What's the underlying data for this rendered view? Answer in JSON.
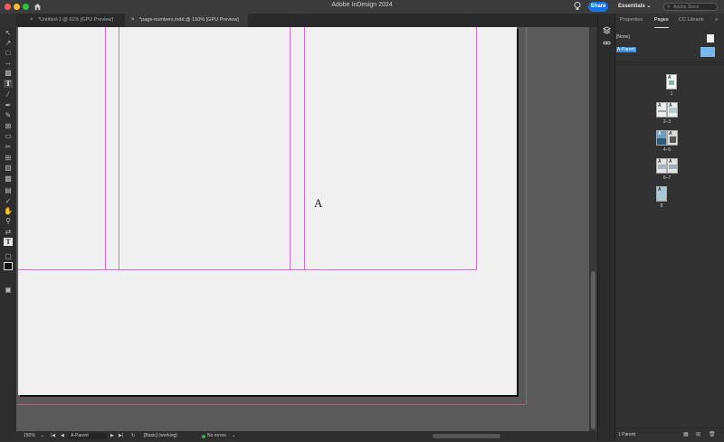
{
  "app": {
    "title": "Adobe InDesign 2024",
    "share_label": "Share",
    "workspace": "Essentials",
    "stock_placeholder": "Adobe Stock"
  },
  "window_controls": {
    "close_color": "#ff5f57",
    "minimize_color": "#febc2e",
    "zoom_color": "#28c840"
  },
  "doc_tabs": [
    {
      "label": "*Untitled-1 @ 61% [GPU Preview]",
      "active": false
    },
    {
      "label": "*page-numbers.indd @ 150% [GPU Preview]",
      "active": true
    }
  ],
  "tools": [
    "selection-icon",
    "direct-selection-icon",
    "page-tool-icon",
    "gap-tool-icon",
    "content-collector-icon",
    "type-tool-icon",
    "line-tool-icon",
    "pen-tool-icon",
    "pencil-tool-icon",
    "rectangle-frame-icon",
    "rectangle-icon",
    "scissors-icon",
    "free-transform-icon",
    "gradient-swatch-icon",
    "gradient-feather-icon",
    "note-tool-icon",
    "eyedropper-icon",
    "hand-tool-icon",
    "zoom-tool-icon",
    "fill-stroke-icon",
    "formatting-affects-icon",
    "fill-color-icon",
    "screen-mode-icon"
  ],
  "canvas": {
    "parent_marker": "A"
  },
  "status": {
    "zoom": "150%",
    "page": "A-Parent",
    "style": "[Basic] (working)",
    "preflight": "No errors",
    "preflight_color": "#37b34a"
  },
  "panel": {
    "tabs": [
      "Properties",
      "Pages",
      "CC Librarie"
    ],
    "active_tab": "Pages",
    "none_label": "[None]",
    "parent_label": "A-Parent",
    "pages": [
      {
        "label": "1",
        "marks": [
          "A"
        ]
      },
      {
        "label": "2–3",
        "marks": [
          "A",
          "A"
        ]
      },
      {
        "label": "4–5",
        "marks": [
          "A",
          "A"
        ]
      },
      {
        "label": "6–7",
        "marks": [
          "A",
          "A"
        ]
      },
      {
        "label": "8",
        "marks": [
          "A"
        ]
      }
    ],
    "footer": "1 Parent"
  }
}
